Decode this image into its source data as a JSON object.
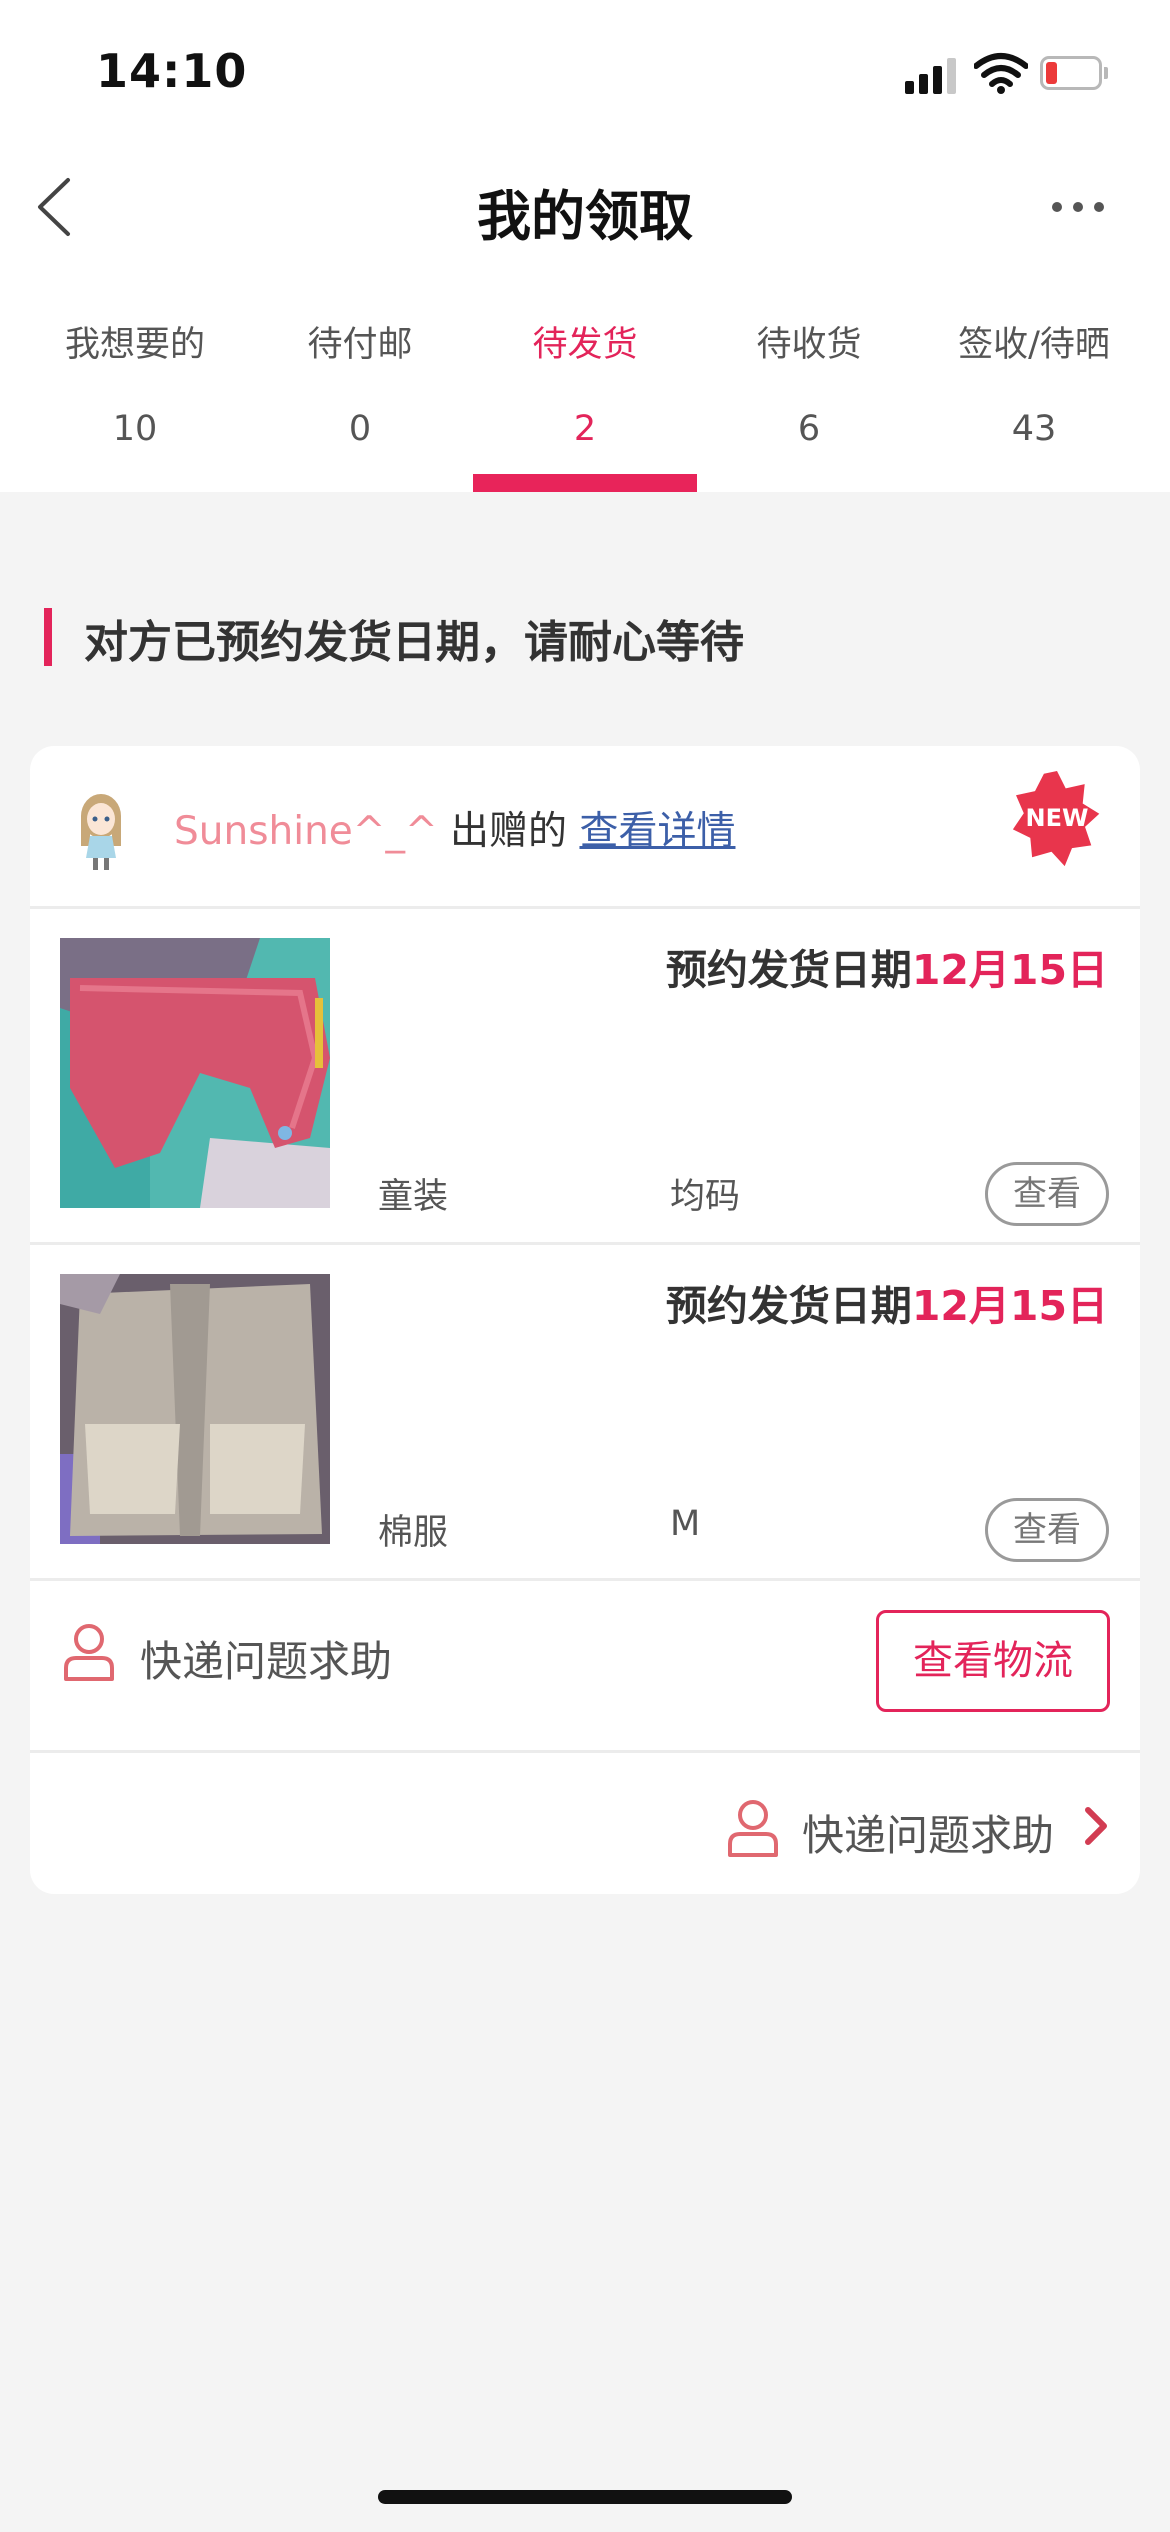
{
  "status_bar": {
    "time": "14:10"
  },
  "nav": {
    "title": "我的领取"
  },
  "tabs": [
    {
      "label": "我想要的",
      "count": "10",
      "active": false
    },
    {
      "label": "待付邮",
      "count": "0",
      "active": false
    },
    {
      "label": "待发货",
      "count": "2",
      "active": true
    },
    {
      "label": "待收货",
      "count": "6",
      "active": false
    },
    {
      "label": "签收/待晒",
      "count": "43",
      "active": false
    }
  ],
  "section": {
    "title": "对方已预约发货日期，请耐心等待"
  },
  "card": {
    "donor_name": "Sunshine^_^",
    "donor_suffix": "出赠的",
    "detail_link": "查看详情",
    "badge": "NEW",
    "items": [
      {
        "schedule_label": "预约发货日期",
        "schedule_date": "12月15日",
        "category": "童装",
        "size": "均码",
        "view_label": "查看"
      },
      {
        "schedule_label": "预约发货日期",
        "schedule_date": "12月15日",
        "category": "棉服",
        "size": "M",
        "view_label": "查看"
      }
    ],
    "help_label": "快递问题求助",
    "logistics_button": "查看物流",
    "help_link": "快递问题求助"
  },
  "colors": {
    "accent": "#e3245a",
    "link": "#3c5fa8",
    "nickname": "#f08c98",
    "background": "#f4f4f4"
  }
}
